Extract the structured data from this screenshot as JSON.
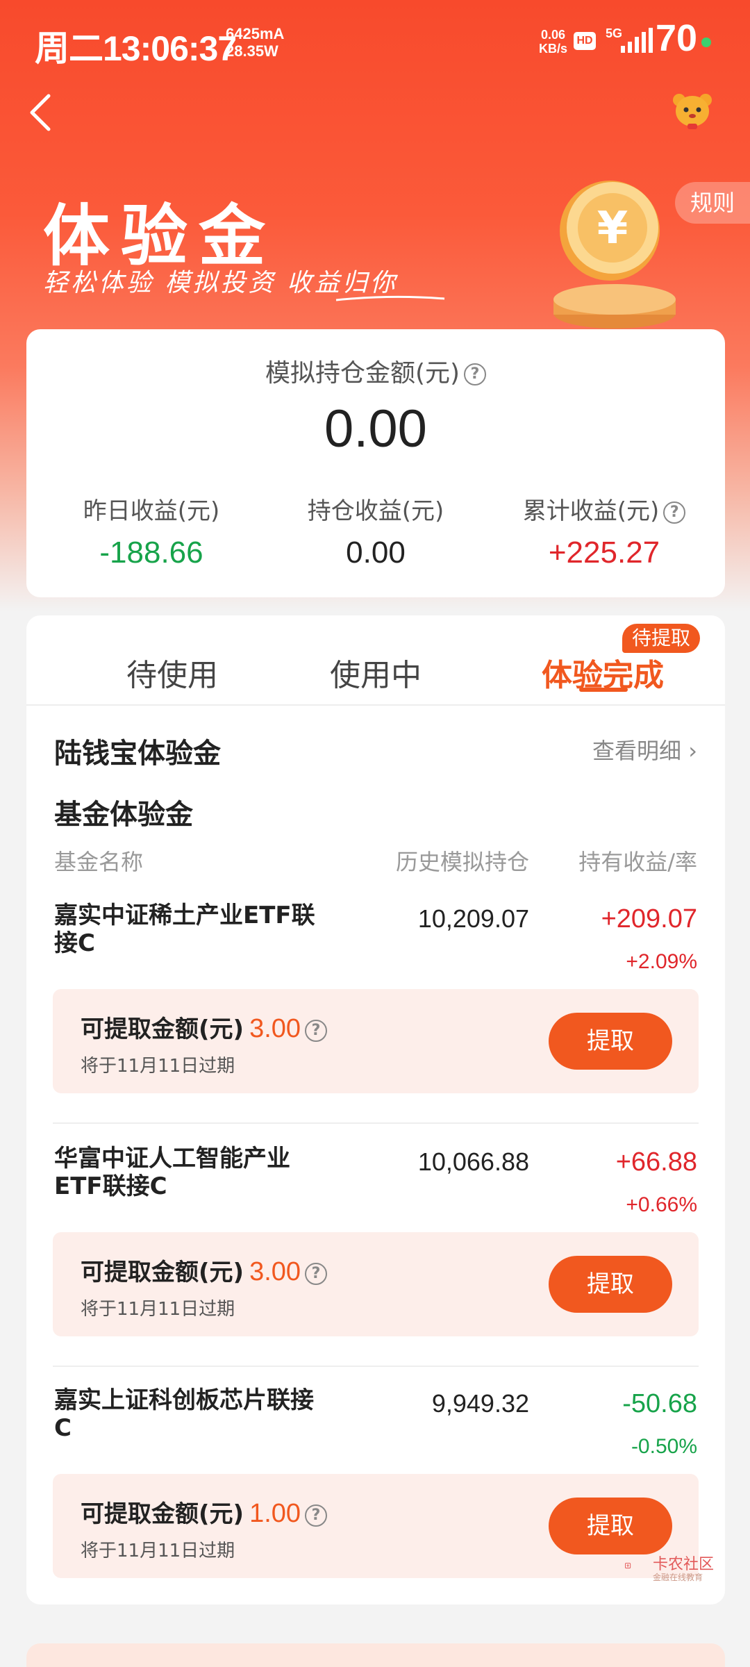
{
  "status_bar": {
    "time": "周二13:06:37",
    "current": "6425mA",
    "power": "28.35W",
    "net_speed_value": "0.06",
    "net_speed_unit": "KB/s",
    "hd": "HD",
    "network": "5G",
    "battery": "70"
  },
  "header": {
    "title": "体验金",
    "slogan": "轻松体验 模拟投资 收益归你",
    "rules": "规则"
  },
  "summary": {
    "label": "模拟持仓金额(元)",
    "amount": "0.00",
    "stats": [
      {
        "label": "昨日收益(元)",
        "value": "-188.66"
      },
      {
        "label": "持仓收益(元)",
        "value": "0.00"
      },
      {
        "label": "累计收益(元)",
        "value": "+225.27"
      }
    ]
  },
  "tabs": [
    {
      "label": "待使用",
      "active": false
    },
    {
      "label": "使用中",
      "active": false
    },
    {
      "label": "体验完成",
      "active": true
    }
  ],
  "tab_badge": "待提取",
  "lqb": {
    "title": "陆钱宝体验金",
    "link": "查看明细"
  },
  "funds_section": {
    "title": "基金体验金",
    "columns": [
      "基金名称",
      "历史模拟持仓",
      "持有收益/率"
    ]
  },
  "funds": [
    {
      "name": "嘉实中证稀土产业ETF联接C",
      "holding": "10,209.07",
      "profit": "+209.07",
      "rate": "+2.09%",
      "withdraw_label": "可提取金额(元)",
      "withdraw_amount": "3.00",
      "expire": "将于11月11日过期",
      "button": "提取"
    },
    {
      "name": "华富中证人工智能产业ETF联接C",
      "holding": "10,066.88",
      "profit": "+66.88",
      "rate": "+0.66%",
      "withdraw_label": "可提取金额(元)",
      "withdraw_amount": "3.00",
      "expire": "将于11月11日过期",
      "button": "提取"
    },
    {
      "name": "嘉实上证科创板芯片联接C",
      "holding": "9,949.32",
      "profit": "-50.68",
      "rate": "-0.50%",
      "withdraw_label": "可提取金额(元)",
      "withdraw_amount": "1.00",
      "expire": "将于11月11日过期",
      "button": "提取"
    }
  ],
  "watermark": {
    "name": "卡农社区",
    "sub": "金融在线教育"
  },
  "colors": {
    "accent": "#f1581f",
    "positive": "#e0262b",
    "negative": "#17a34a"
  }
}
